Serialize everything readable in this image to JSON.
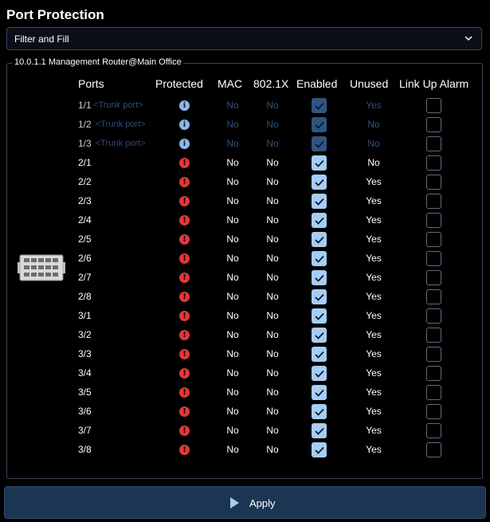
{
  "page": {
    "title": "Port Protection"
  },
  "filter": {
    "label": "Filter and Fill",
    "icon": "chevron-down-icon"
  },
  "device": {
    "name": "10.0.1.1 Management Router@Main Office",
    "icon": "router-device-icon"
  },
  "table": {
    "headers": {
      "ports": "Ports",
      "protected": "Protected",
      "mac": "MAC",
      "dot1x": "802.1X",
      "enabled": "Enabled",
      "unused": "Unused",
      "link_up_alarm": "Link Up Alarm"
    },
    "rows": [
      {
        "port": "1/1",
        "note": "<Trunk port>",
        "status": "info",
        "mac": "No",
        "dot1x": "No",
        "enabled": true,
        "unused": "Yes",
        "alarm": false,
        "disabled": true
      },
      {
        "port": "1/2",
        "note": "<Trunk port>",
        "status": "info",
        "mac": "No",
        "dot1x": "No",
        "enabled": true,
        "unused": "No",
        "alarm": false,
        "disabled": true
      },
      {
        "port": "1/3",
        "note": "<Trunk port>",
        "status": "info",
        "mac": "No",
        "dot1x": "No",
        "enabled": true,
        "unused": "No",
        "alarm": false,
        "disabled": true
      },
      {
        "port": "2/1",
        "note": "",
        "status": "error",
        "mac": "No",
        "dot1x": "No",
        "enabled": true,
        "unused": "No",
        "alarm": false,
        "disabled": false
      },
      {
        "port": "2/2",
        "note": "",
        "status": "error",
        "mac": "No",
        "dot1x": "No",
        "enabled": true,
        "unused": "Yes",
        "alarm": false,
        "disabled": false
      },
      {
        "port": "2/3",
        "note": "",
        "status": "error",
        "mac": "No",
        "dot1x": "No",
        "enabled": true,
        "unused": "Yes",
        "alarm": false,
        "disabled": false
      },
      {
        "port": "2/4",
        "note": "",
        "status": "error",
        "mac": "No",
        "dot1x": "No",
        "enabled": true,
        "unused": "Yes",
        "alarm": false,
        "disabled": false
      },
      {
        "port": "2/5",
        "note": "",
        "status": "error",
        "mac": "No",
        "dot1x": "No",
        "enabled": true,
        "unused": "Yes",
        "alarm": false,
        "disabled": false
      },
      {
        "port": "2/6",
        "note": "",
        "status": "error",
        "mac": "No",
        "dot1x": "No",
        "enabled": true,
        "unused": "Yes",
        "alarm": false,
        "disabled": false
      },
      {
        "port": "2/7",
        "note": "",
        "status": "error",
        "mac": "No",
        "dot1x": "No",
        "enabled": true,
        "unused": "Yes",
        "alarm": false,
        "disabled": false
      },
      {
        "port": "2/8",
        "note": "",
        "status": "error",
        "mac": "No",
        "dot1x": "No",
        "enabled": true,
        "unused": "Yes",
        "alarm": false,
        "disabled": false
      },
      {
        "port": "3/1",
        "note": "",
        "status": "error",
        "mac": "No",
        "dot1x": "No",
        "enabled": true,
        "unused": "Yes",
        "alarm": false,
        "disabled": false
      },
      {
        "port": "3/2",
        "note": "",
        "status": "error",
        "mac": "No",
        "dot1x": "No",
        "enabled": true,
        "unused": "Yes",
        "alarm": false,
        "disabled": false
      },
      {
        "port": "3/3",
        "note": "",
        "status": "error",
        "mac": "No",
        "dot1x": "No",
        "enabled": true,
        "unused": "Yes",
        "alarm": false,
        "disabled": false
      },
      {
        "port": "3/4",
        "note": "",
        "status": "error",
        "mac": "No",
        "dot1x": "No",
        "enabled": true,
        "unused": "Yes",
        "alarm": false,
        "disabled": false
      },
      {
        "port": "3/5",
        "note": "",
        "status": "error",
        "mac": "No",
        "dot1x": "No",
        "enabled": true,
        "unused": "Yes",
        "alarm": false,
        "disabled": false
      },
      {
        "port": "3/6",
        "note": "",
        "status": "error",
        "mac": "No",
        "dot1x": "No",
        "enabled": true,
        "unused": "Yes",
        "alarm": false,
        "disabled": false
      },
      {
        "port": "3/7",
        "note": "",
        "status": "error",
        "mac": "No",
        "dot1x": "No",
        "enabled": true,
        "unused": "Yes",
        "alarm": false,
        "disabled": false
      },
      {
        "port": "3/8",
        "note": "",
        "status": "error",
        "mac": "No",
        "dot1x": "No",
        "enabled": true,
        "unused": "Yes",
        "alarm": false,
        "disabled": false
      }
    ]
  },
  "apply": {
    "label": "Apply",
    "icon": "play-icon"
  },
  "colors": {
    "accent": "#a6cdf4",
    "error": "#e23838",
    "info": "#8fb8e6",
    "border": "#2e4866"
  }
}
